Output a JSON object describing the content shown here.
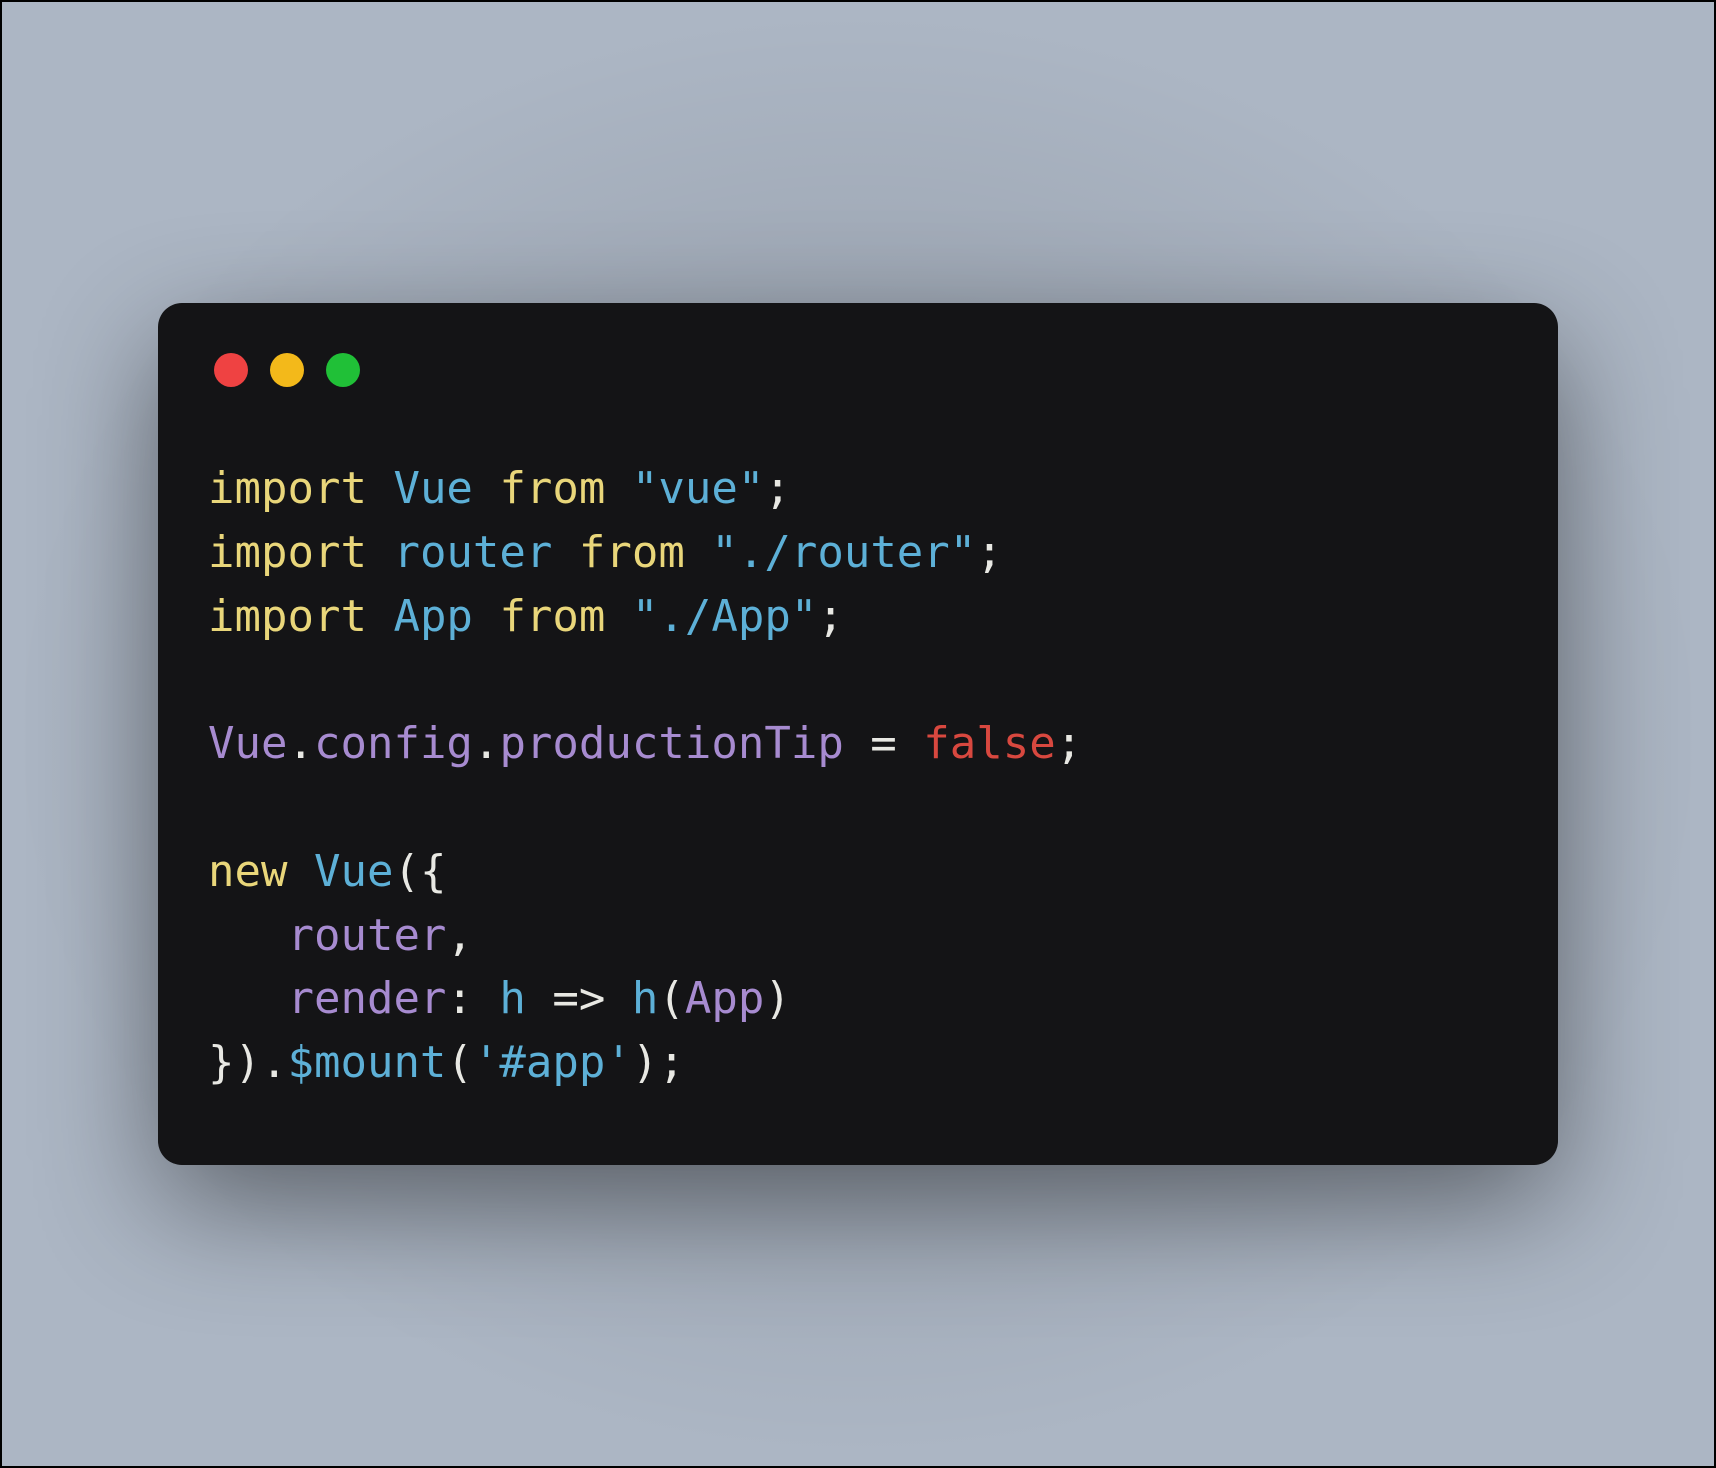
{
  "window": {
    "traffic_lights": [
      "close",
      "minimize",
      "zoom"
    ]
  },
  "code": {
    "line1": {
      "kw1": "import",
      "id": "Vue",
      "kw2": "from",
      "str": "\"vue\"",
      "semi": ";"
    },
    "line2": {
      "kw1": "import",
      "id": "router",
      "kw2": "from",
      "str": "\"./router\"",
      "semi": ";"
    },
    "line3": {
      "kw1": "import",
      "id": "App",
      "kw2": "from",
      "str": "\"./App\"",
      "semi": ";"
    },
    "line5": {
      "obj": "Vue",
      "dot1": ".",
      "p1": "config",
      "dot2": ".",
      "p2": "productionTip",
      "eq": " = ",
      "val": "false",
      "semi": ";"
    },
    "line7": {
      "kw": "new",
      "id": "Vue",
      "open": "({"
    },
    "line8": {
      "pad": "   ",
      "prop": "router",
      "comma": ","
    },
    "line9": {
      "pad": "   ",
      "prop": "render",
      "colon": ": ",
      "h1": "h",
      "arrow": " => ",
      "h2": "h",
      "lp": "(",
      "app": "App",
      "rp": ")"
    },
    "line10": {
      "close": "}).",
      "mount": "$mount",
      "lp": "(",
      "str": "'#app'",
      "rp": ")",
      "semi": ";"
    }
  }
}
